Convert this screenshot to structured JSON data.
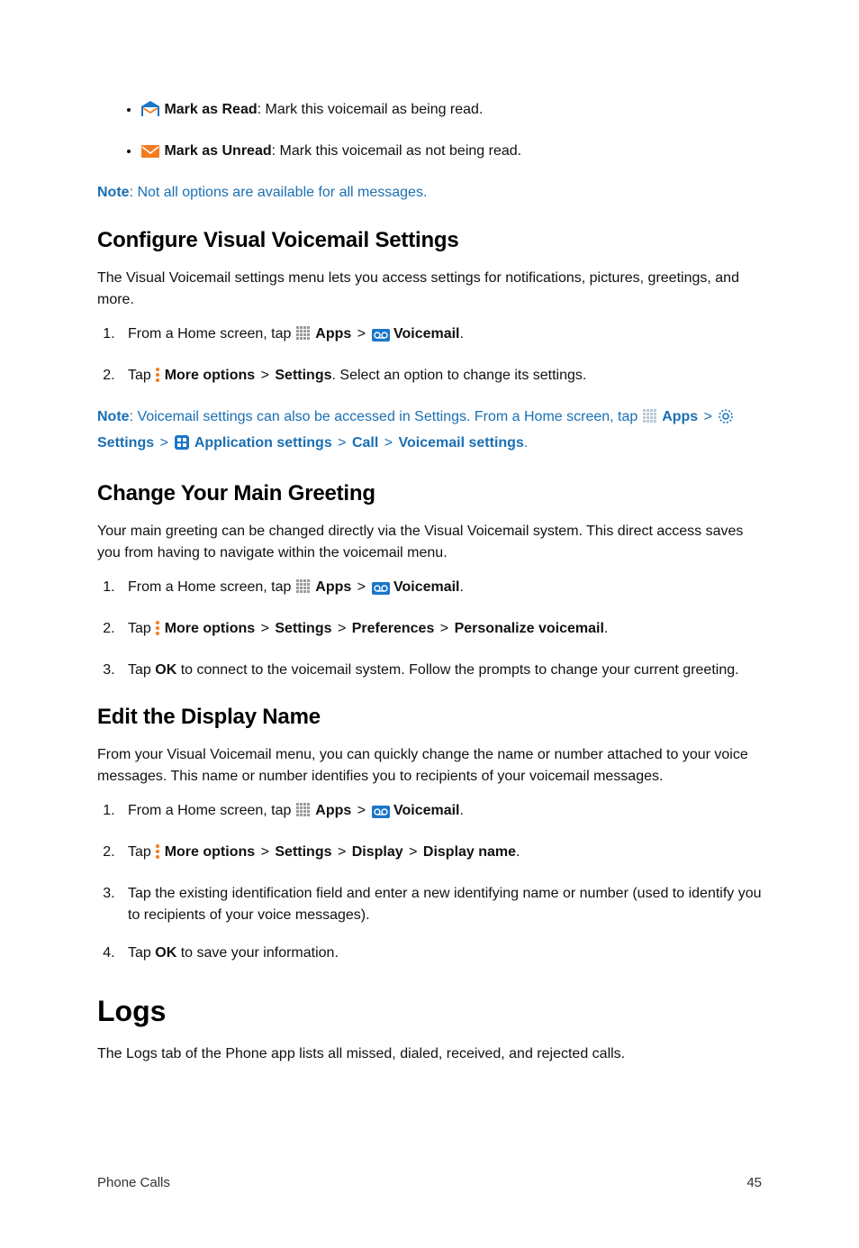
{
  "bullets": {
    "markRead": {
      "label": "Mark as Read",
      "desc": ": Mark this voicemail as being read."
    },
    "markUnread": {
      "label": "Mark as Unread",
      "desc": ": Mark this voicemail as not being read."
    }
  },
  "note1": {
    "label": "Note",
    "text": ": Not all options are available for all messages."
  },
  "sec1": {
    "heading": "Configure Visual Voicemail Settings",
    "intro": "The Visual Voicemail settings menu lets you access settings for notifications, pictures, greetings, and more.",
    "step1_pre": "From a Home screen, tap ",
    "apps": "Apps",
    "gt": " > ",
    "voicemail": "Voicemail",
    "period": ".",
    "step2_pre": "Tap ",
    "moreoptions": "More options",
    "settings": "Settings",
    "step2_post": ". Select an option to change its settings."
  },
  "note2": {
    "label": "Note",
    "t1": ": Voicemail settings can also be accessed in Settings. From a Home screen, tap ",
    "apps": "Apps",
    "gt": " > ",
    "settings": "Settings",
    "appset": "Application settings",
    "call": "Call",
    "vmset": "Voicemail settings",
    "period": "."
  },
  "sec2": {
    "heading": "Change Your Main Greeting",
    "intro": "Your main greeting can be changed directly via the Visual Voicemail system. This direct access saves you from having to navigate within the voicemail menu.",
    "step1_pre": "From a Home screen, tap ",
    "apps": "Apps",
    "gt": " > ",
    "voicemail": "Voicemail",
    "period": ".",
    "step2_pre": "Tap ",
    "moreoptions": "More options",
    "settings": "Settings",
    "prefs": "Preferences",
    "personalize": "Personalize voicemail",
    "step3_pre": "Tap ",
    "ok": "OK",
    "step3_post": " to connect to the voicemail system. Follow the prompts to change your current greeting."
  },
  "sec3": {
    "heading": "Edit the Display Name",
    "intro": "From your Visual Voicemail menu, you can quickly change the name or number attached to your voice messages. This name or number identifies you to recipients of your voicemail messages.",
    "step1_pre": "From a Home screen, tap ",
    "apps": "Apps",
    "gt": " > ",
    "voicemail": "Voicemail",
    "period": ".",
    "step2_pre": "Tap ",
    "moreoptions": "More options",
    "settings": "Settings",
    "display": "Display",
    "displayname": "Display name",
    "step3": "Tap the existing identification field and enter a new identifying name or number (used to identify you to recipients of your voice messages).",
    "step4_pre": "Tap ",
    "ok": "OK",
    "step4_post": " to save your information."
  },
  "logs": {
    "heading": "Logs",
    "intro": "The Logs tab of the Phone app lists all missed, dialed, received, and rejected calls."
  },
  "footer": {
    "left": "Phone Calls",
    "right": "45"
  }
}
